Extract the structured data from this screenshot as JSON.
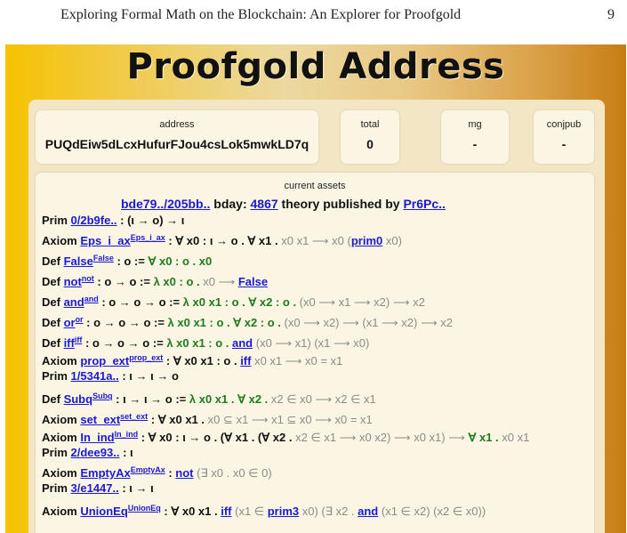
{
  "running_head": {
    "title": "Exploring Formal Math on the Blockchain: An Explorer for Proofgold",
    "page_number": "9"
  },
  "page_title": "Proofgold Address",
  "address_card": {
    "label": "address",
    "value": "PUQdEiw5dLcxHufurFJou4csLok5mwkLD7q"
  },
  "total_card": {
    "label": "total",
    "value": "0"
  },
  "mg_card": {
    "label": "mg",
    "value": "-"
  },
  "conjpub_card": {
    "label": "conjpub",
    "value": "-"
  },
  "assets": {
    "header": "current assets",
    "bday_line": {
      "asset_link": "bde79../205bb..",
      "bday_label": "bday:",
      "bday_value": "4867",
      "mid_text": "theory published by",
      "publisher": "Pr6Pc.."
    },
    "lines": [
      {
        "kind": "prim",
        "k": "Prim",
        "a": "0/2b9fe..",
        "b": ": (ι → o) → ι",
        "tight": true
      },
      {
        "kind": "axiom",
        "k": "Axiom",
        "a": "Eps_i_ax",
        "s": "Eps_i_ax",
        "b": ": ∀ x0 : ι → o . ∀ x1 .",
        "g": " x0 x1 ⟶ x0 (",
        "p": "prim0",
        "e": " x0)"
      },
      {
        "kind": "def",
        "k": "Def",
        "a": "False",
        "s": "False",
        "b": ": o := ",
        "c": "∀ x0 : o . x0"
      },
      {
        "kind": "def",
        "k": "Def",
        "a": "not",
        "s": "not",
        "b": ": o → o := ",
        "c": "λ x0 : o . ",
        "d": "x0 ⟶ ",
        "u": "False"
      },
      {
        "kind": "def",
        "k": "Def",
        "a": "and",
        "s": "and",
        "b": ": o → o → o := ",
        "c": "λ x0 x1 : o . ∀ x2 : o . ",
        "d": "(x0 ⟶ x1 ⟶ x2) ⟶ x2"
      },
      {
        "kind": "def",
        "k": "Def",
        "a": "or",
        "s": "or",
        "b": ": o → o → o := ",
        "c": "λ x0 x1 : o . ∀ x2 : o . ",
        "d": "(x0 ⟶ x2) ⟶ (x1 ⟶ x2) ⟶ x2"
      },
      {
        "kind": "def",
        "k": "Def",
        "a": "iff",
        "s": "iff",
        "b": ": o → o → o := ",
        "c": "λ x0 x1 : o . ",
        "u": "and",
        "d": " (x0 ⟶ x1) (x1 ⟶ x0)"
      },
      {
        "kind": "axiom",
        "k": "Axiom",
        "a": "prop_ext",
        "s": "prop_ext",
        "b": ": ∀ x0 x1 : o . ",
        "u": "iff",
        "g": " x0 x1 ⟶ x0 = x1",
        "tight": true
      },
      {
        "kind": "prim",
        "k": "Prim",
        "a": "1/5341a..",
        "b": ": ι → ι → o"
      },
      {
        "kind": "def",
        "k": "Def",
        "a": "Subq",
        "s": "Subq",
        "b": ": ι → ι → o := ",
        "c": "λ x0 x1 . ∀ x2 . ",
        "d": "x2 ∈ x0 ⟶ x2 ∈ x1"
      },
      {
        "kind": "axiom",
        "k": "Axiom",
        "a": "set_ext",
        "s": "set_ext",
        "b": ": ∀ x0 x1 .",
        "g": " x0 ⊆ x1 ⟶ x1 ⊆ x0 ⟶ x0 = x1"
      },
      {
        "kind": "axiom",
        "k": "Axiom",
        "a": "In_ind",
        "s": "In_ind",
        "b": ": ∀ x0 : ι → o . (∀ x1 . (∀ x2 .",
        "g": " x2 ∈ x1 ⟶ x0 x2) ⟶ x0 x1) ⟶ ",
        "c": "∀ x1 .",
        "d2": " x0 x1",
        "tight": true
      },
      {
        "kind": "prim",
        "k": "Prim",
        "a": "2/dee93..",
        "b": ": ι"
      },
      {
        "kind": "axiom",
        "k": "Axiom",
        "a": "EmptyAx",
        "s": "EmptyAx",
        "b": ": ",
        "u": "not",
        "d": " (∃ x0 . x0 ∈ 0)",
        "tight": true
      },
      {
        "kind": "prim",
        "k": "Prim",
        "a": "3/e1447..",
        "b": ": ι → ι"
      },
      {
        "kind": "axiom",
        "k": "Axiom",
        "a": "UnionEq",
        "s": "UnionEq",
        "b": ": ∀ x0 x1 . ",
        "u": "iff",
        "g": " (x1 ∈ ",
        "p": "prim3",
        "e": " x0) (∃ x2 . ",
        "u2": "and",
        "e2": " (x1 ∈ x2) (x2 ∈ x0))"
      }
    ]
  }
}
